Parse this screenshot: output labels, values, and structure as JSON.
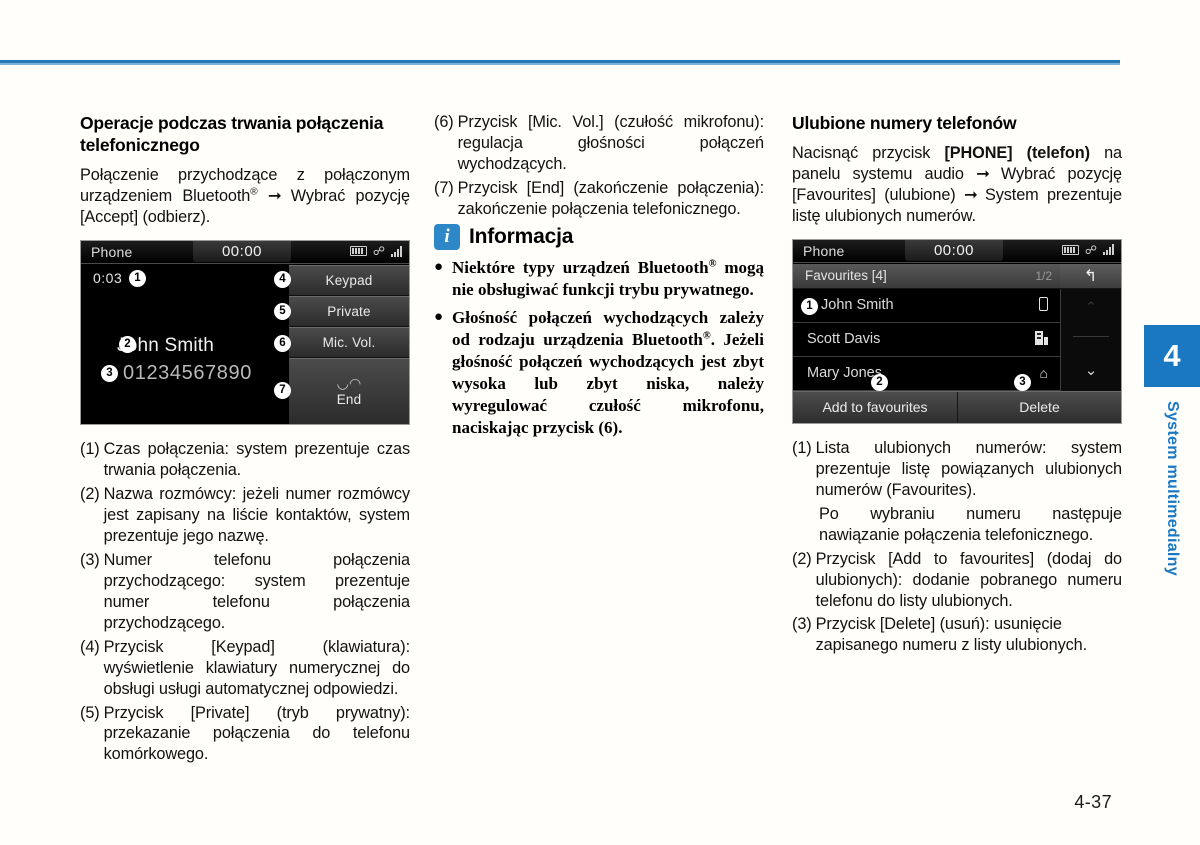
{
  "page": {
    "number": "4-37",
    "chapter_tab": {
      "number": "4",
      "label": "System multimedialny",
      "color": "#1a78c2"
    },
    "rule_color": "#2378b8"
  },
  "col1": {
    "heading": "Operacje podczas trwania połączenia telefonicznego",
    "intro_a": "Połączenie przychodzące z połączonym urządzeniem Bluetooth",
    "intro_reg": "®",
    "intro_arrow": "➞",
    "intro_b": "Wybrać pozycję [Accept] (odbierz).",
    "items": [
      {
        "marker": "(1)",
        "text": "Czas połączenia: system prezentuje czas trwania połączenia."
      },
      {
        "marker": "(2)",
        "text": "Nazwa rozmówcy: jeżeli numer rozmówcy jest zapisany na liście kontaktów, system prezentuje jego nazwę."
      },
      {
        "marker": "(3)",
        "text": "Numer telefonu połączenia przychodzącego: system prezentuje numer telefonu połączenia przychodzącego."
      },
      {
        "marker": "(4)",
        "text": "Przycisk [Keypad] (klawiatura): wyświetlenie klawiatury numerycznej do obsługi usługi automatycznej odpowiedzi."
      },
      {
        "marker": "(5)",
        "text": "Przycisk [Private] (tryb prywatny): przekazanie połączenia do telefonu komórkowego."
      }
    ]
  },
  "col2": {
    "items": [
      {
        "marker": "(6)",
        "text": "Przycisk [Mic. Vol.] (czułość mikrofonu): regulacja głośności połączeń wychodzących."
      },
      {
        "marker": "(7)",
        "text": "Przycisk [End] (zakończenie połączenia): zakończenie połączenia telefonicznego."
      }
    ],
    "info": {
      "badge": "i",
      "title": "Informacja",
      "bullets": [
        {
          "text_a": "Niektóre typy urządzeń Bluetooth",
          "reg": "®",
          "text_b": " mogą nie obsługiwać funkcji trybu prywatnego."
        },
        {
          "text_a": "Głośność połączeń wychodzących zależy od rodzaju urządzenia Bluetooth",
          "reg": "®",
          "text_b": ". Jeżeli głośność połączeń wychodzących jest zbyt wysoka lub zbyt niska, należy wyregulować czułość mikrofonu, naciskając przycisk (6)."
        }
      ]
    }
  },
  "col3": {
    "heading": "Ulubione numery telefonów",
    "intro_a": "Nacisnąć przycisk ",
    "intro_bold": "[PHONE] (telefon)",
    "intro_b": " na panelu systemu audio ",
    "intro_arrow1": "➞",
    "intro_c": " Wybrać pozycję [Favourites] (ulubione) ",
    "intro_arrow2": "➞",
    "intro_d": " System prezentuje listę ulubionych numerów.",
    "items": [
      {
        "marker": "(1)",
        "text": "Lista ulubionych numerów: system prezentuje listę powiązanych ulubionych numerów (Favourites)."
      },
      {
        "marker": "(2)",
        "text": "Przycisk [Add to favourites] (dodaj do ulubionych): dodanie pobranego numeru telefonu do listy ulubionych."
      },
      {
        "marker": "(3)",
        "text": "Przycisk [Delete] (usuń): usunięcie zapisanego numeru z listy ulubionych."
      }
    ],
    "sub_paragraph": "Po wybraniu numeru następuje nawiązanie połączenia telefonicznego."
  },
  "screen_call": {
    "status_title": "Phone",
    "clock": "00:00",
    "duration": "0:03",
    "caller_name": "John Smith",
    "caller_number": "01234567890",
    "buttons": [
      {
        "label": "Keypad",
        "marker": "4"
      },
      {
        "label": "Private",
        "marker": "5"
      },
      {
        "label": "Mic. Vol.",
        "marker": "6"
      },
      {
        "label": "End",
        "marker": "7"
      }
    ],
    "markers": {
      "m1": "1",
      "m2": "2",
      "m3": "3"
    }
  },
  "screen_fav": {
    "status_title": "Phone",
    "clock": "00:00",
    "list_title": "Favourites [4]",
    "page_indicator": "1/2",
    "back_icon": "↰",
    "rows": [
      {
        "name": "John Smith",
        "type": "mobile",
        "marker": "1"
      },
      {
        "name": "Scott Davis",
        "type": "office",
        "marker": ""
      },
      {
        "name": "Mary Jones",
        "type": "home",
        "marker": ""
      }
    ],
    "home_glyph": "⌂",
    "up_glyph": "⌃",
    "down_glyph": "⌄",
    "bottom_buttons": [
      {
        "label": "Add to favourites",
        "marker": "2"
      },
      {
        "label": "Delete",
        "marker": "3"
      }
    ]
  }
}
